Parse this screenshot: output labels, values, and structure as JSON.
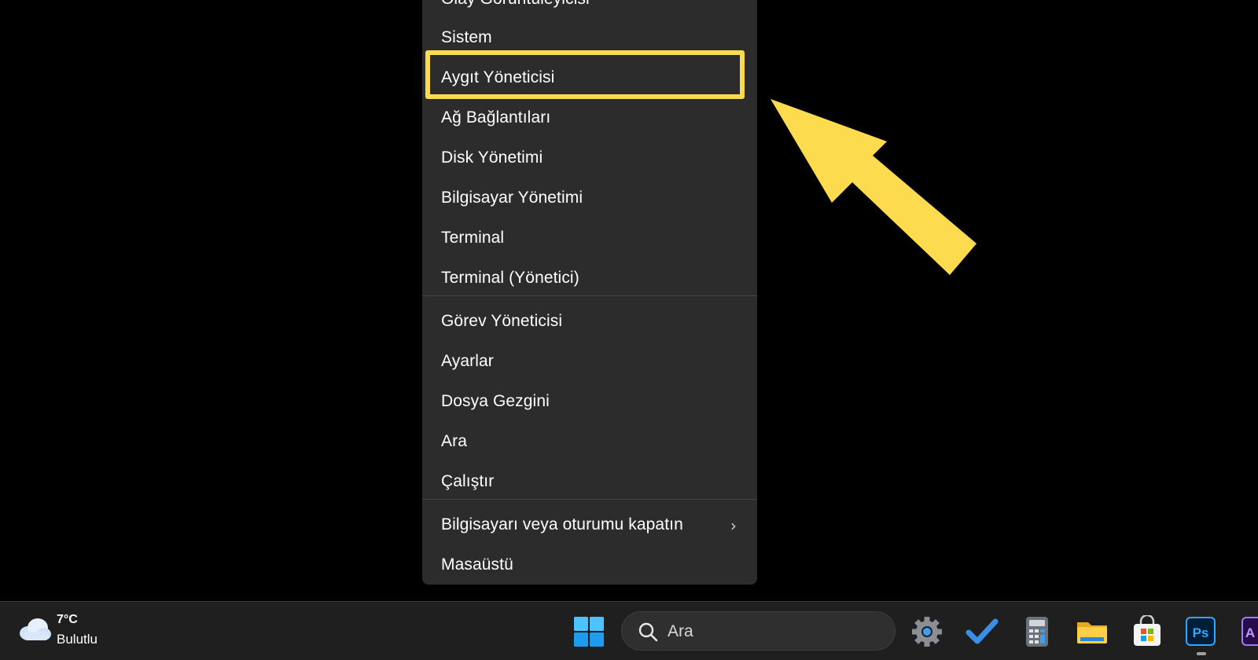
{
  "context_menu": {
    "items": [
      {
        "label": "Olay Görüntüleyicisi"
      },
      {
        "label": "Sistem"
      },
      {
        "label": "Aygıt Yöneticisi"
      },
      {
        "label": "Ağ Bağlantıları"
      },
      {
        "label": "Disk Yönetimi"
      },
      {
        "label": "Bilgisayar Yönetimi"
      },
      {
        "label": "Terminal"
      },
      {
        "label": "Terminal (Yönetici)"
      },
      {
        "label": "Görev Yöneticisi"
      },
      {
        "label": "Ayarlar"
      },
      {
        "label": "Dosya Gezgini"
      },
      {
        "label": "Ara"
      },
      {
        "label": "Çalıştır"
      },
      {
        "label": "Bilgisayarı veya oturumu kapatın"
      },
      {
        "label": "Masaüstü"
      }
    ],
    "highlighted_item": "Aygıt Yöneticisi",
    "submenu_indicator_icon": "chevron-right-icon"
  },
  "annotation": {
    "highlight_color": "#fcdb4f",
    "arrow_color": "#fcdb4f",
    "arrow_icon": "pointer-arrow-icon"
  },
  "taskbar": {
    "weather": {
      "temperature": "7°C",
      "condition": "Bulutlu",
      "icon": "cloud-icon"
    },
    "start_icon": "windows-start-icon",
    "search": {
      "placeholder": "Ara",
      "icon": "search-icon"
    },
    "pinned_icons": [
      "settings-icon",
      "todo-check-icon",
      "calculator-icon",
      "file-explorer-icon",
      "microsoft-store-icon",
      "photoshop-icon",
      "adobe-app-icon"
    ],
    "photoshop_label": "Ps",
    "adobe_label": "A"
  },
  "colors": {
    "menu_background": "#2c2c2c",
    "taskbar_background": "#1f1f1f",
    "accent_yellow": "#fcdb4f",
    "windows_blue": "#3a9ff5"
  }
}
